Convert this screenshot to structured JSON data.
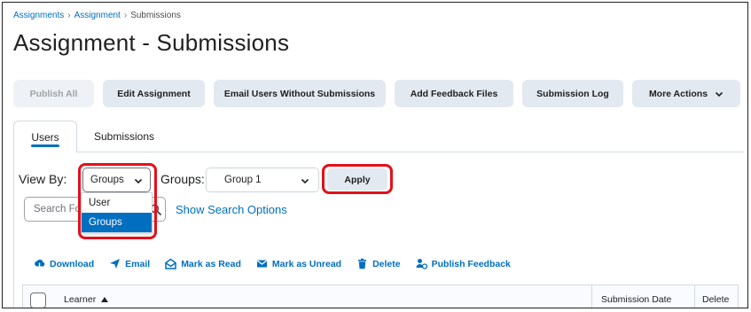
{
  "breadcrumb": {
    "items": [
      "Assignments",
      "Assignment",
      "Submissions"
    ]
  },
  "page": {
    "title": "Assignment - Submissions"
  },
  "toolbar": {
    "publish_all": "Publish All",
    "edit_assignment": "Edit Assignment",
    "email_users": "Email Users Without Submissions",
    "add_feedback": "Add Feedback Files",
    "submission_log": "Submission Log",
    "more_actions": "More Actions"
  },
  "tabs": [
    {
      "label": "Users",
      "active": true
    },
    {
      "label": "Submissions",
      "active": false
    }
  ],
  "filters": {
    "view_by_label": "View By:",
    "view_by_value": "Groups",
    "view_by_options": [
      "User",
      "Groups"
    ],
    "view_by_selected_option": "Groups",
    "groups_label": "Groups:",
    "groups_value": "Group 1",
    "apply_label": "Apply",
    "search_placeholder": "Search For",
    "show_search_options": "Show Search Options"
  },
  "actions": [
    {
      "label": "Download",
      "icon": "cloud-download-icon"
    },
    {
      "label": "Email",
      "icon": "send-icon"
    },
    {
      "label": "Mark as Read",
      "icon": "envelope-open-icon"
    },
    {
      "label": "Mark as Unread",
      "icon": "envelope-icon"
    },
    {
      "label": "Delete",
      "icon": "trash-icon"
    },
    {
      "label": "Publish Feedback",
      "icon": "publish-feedback-icon"
    }
  ],
  "table": {
    "columns": [
      "Learner",
      "Submission Date",
      "Delete"
    ]
  },
  "colors": {
    "accent": "#006fbf",
    "highlight": "#e3101b",
    "button_bg": "#e3e9f1"
  }
}
